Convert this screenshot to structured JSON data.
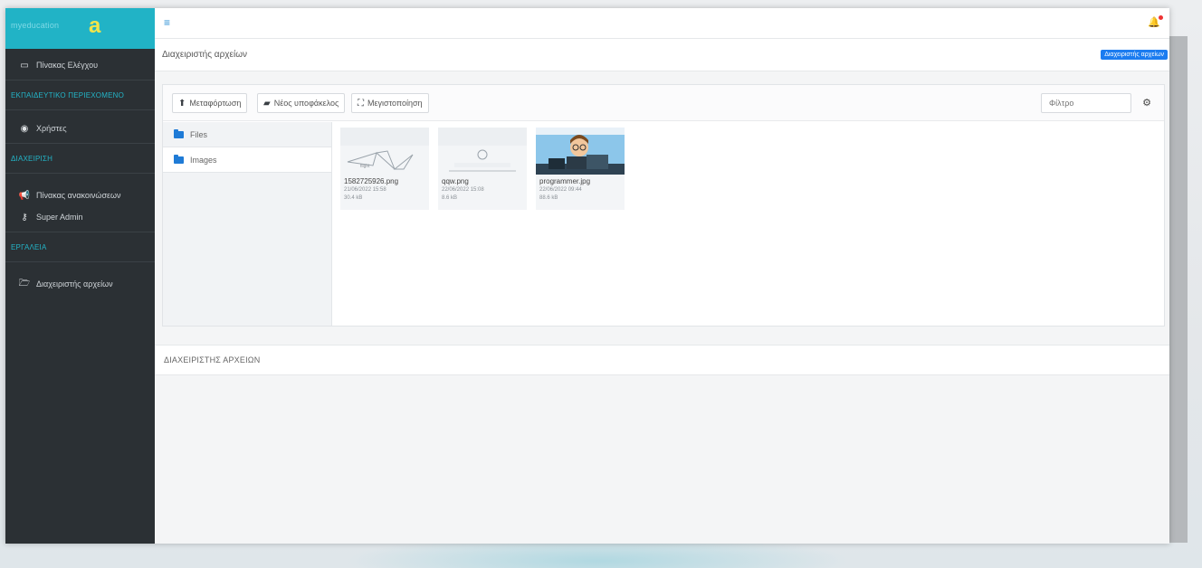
{
  "brand": {
    "text": "myeducation",
    "mark": "a"
  },
  "sidebar": {
    "items": [
      {
        "icon": "monitor-icon",
        "label": "Πίνακας Ελέγχου"
      },
      {
        "header": "ΕΚΠΑΙΔΕΥΤΙΚΟ ΠΕΡΙΕΧΟΜΕΝΟ"
      },
      {
        "icon": "user-circle-icon",
        "label": "Χρήστες"
      },
      {
        "header": "ΔΙΑΧΕΙΡΙΣΗ"
      },
      {
        "icon": "megaphone-icon",
        "label": "Πίνακας ανακοινώσεων"
      },
      {
        "icon": "user-key-icon",
        "label": "Super Admin"
      },
      {
        "header": "ΕΡΓΑΛΕΙΑ"
      },
      {
        "icon": "folder-open-icon",
        "label": "Διαχειριστής αρχείων"
      }
    ]
  },
  "topbar": {
    "menu_icon": "≡",
    "bell_icon": "🔔"
  },
  "page": {
    "title": "Διαχειριστής αρχείων",
    "badge": "Διαχειριστής αρχείων"
  },
  "toolbar": {
    "upload_label": "Μεταφόρτωση",
    "new_folder_label": "Νέος υποφάκελος",
    "fullscreen_label": "Μεγιστοποίηση",
    "filter_placeholder": "Φίλτρο"
  },
  "tree": {
    "items": [
      "Files",
      "Images"
    ]
  },
  "files": [
    {
      "name": "1582725926.png",
      "date": "21/06/2022 15:58",
      "size": "30.4 kB"
    },
    {
      "name": "qqw.png",
      "date": "22/06/2022 15:08",
      "size": "8.6 kB"
    },
    {
      "name": "programmer.jpg",
      "date": "22/06/2022 09:44",
      "size": "88.6 kB"
    }
  ],
  "section": {
    "title": "ΔΙΑΧΕΙΡΙΣΤΗΣ ΑΡΧΕΙΩΝ"
  },
  "colors": {
    "accent": "#21b3c6",
    "sidebar": "#2b3034",
    "primary": "#1b7cf0"
  }
}
